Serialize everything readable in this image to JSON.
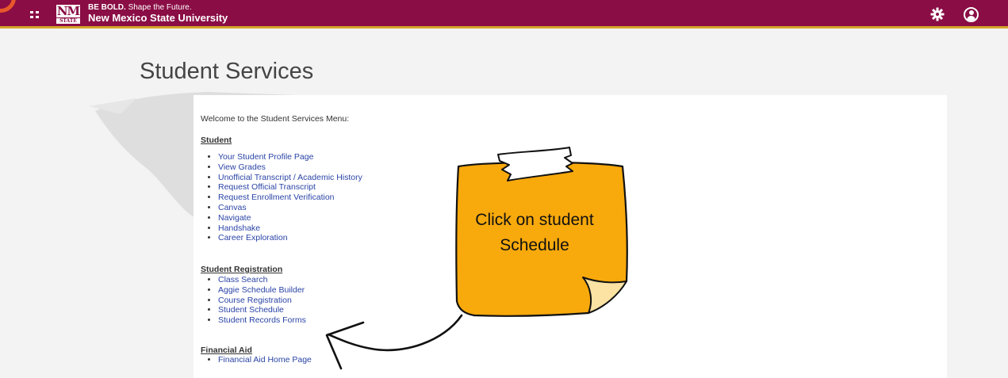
{
  "header": {
    "tagline_bold": "BE BOLD.",
    "tagline_rest": "Shape the Future.",
    "university_name": "New Mexico State University",
    "logo_top": "NM",
    "logo_bottom": "STATE",
    "icons": [
      "apps-grid-icon",
      "gear-icon",
      "user-account-icon"
    ]
  },
  "page": {
    "title": "Student Services",
    "welcome": "Welcome to the Student Services Menu:"
  },
  "sections": {
    "student": {
      "heading": "Student",
      "links": [
        "Your Student Profile Page",
        "View Grades",
        "Unofficial Transcript / Academic History",
        "Request Official Transcript",
        "Request Enrollment Verification",
        "Canvas",
        "Navigate",
        "Handshake",
        "Career Exploration"
      ]
    },
    "registration": {
      "heading": "Student Registration",
      "links": [
        "Class Search",
        "Aggie Schedule Builder",
        "Course Registration",
        "Student Schedule",
        "Student Records Forms"
      ]
    },
    "financial_aid": {
      "heading": "Financial Aid",
      "links": [
        "Financial Aid Home Page"
      ]
    }
  },
  "annotation": {
    "line1": "Click on student",
    "line2": "Schedule",
    "note_color": "#f8a90c",
    "curl_color": "#fce3a3"
  },
  "colors": {
    "header_bg": "#8a0d45",
    "header_accent": "#d5a52a",
    "link": "#2a44a6",
    "page_bg": "#f3f3f3"
  }
}
